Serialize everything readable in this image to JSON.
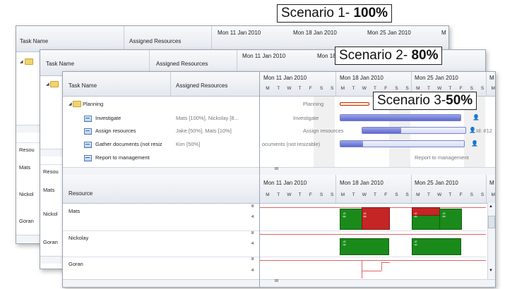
{
  "scenarios": {
    "s1": {
      "text": "Scenario 1- ",
      "bold": "100%"
    },
    "s2": {
      "text": "Scenario 2- ",
      "bold": "80%"
    },
    "s3": {
      "text": "Scenario 3-",
      "bold": "50%"
    }
  },
  "columns": {
    "task_name": "Task Name",
    "assigned_resources": "Assigned Resources",
    "resource": "Resource"
  },
  "weeks": [
    "Mon 11 Jan 2010",
    "Mon 18 Jan 2010",
    "Mon 25 Jan 2010",
    "M"
  ],
  "days": [
    "M",
    "T",
    "W",
    "T",
    "F",
    "S",
    "S"
  ],
  "tasks": [
    {
      "name": "Planning",
      "resources": ""
    },
    {
      "name": "Investigate",
      "resources": "Mats [100%], Nickolay [8..."
    },
    {
      "name": "Assign resources",
      "resources": "Jake [50%], Mats [10%]"
    },
    {
      "name": "Gather documents (not resiz",
      "resources": "Kim [50%]"
    },
    {
      "name": "Report to management",
      "resources": ""
    }
  ],
  "gantt_labels": {
    "planning": "Planning",
    "investigate": "Investigate",
    "assign": "Assign resources",
    "gather": "ocuments (not resizable)",
    "report": "Report to management",
    "id12": "Id: #12"
  },
  "resources": [
    "Mats",
    "Nickolay",
    "Goran"
  ],
  "back_resources": [
    "Resou",
    "Mats",
    "Nickol",
    "Goran"
  ],
  "scrollbar_thumb": "III",
  "axis_ticks": {
    "top": "8",
    "mid": "4"
  },
  "histogram_labels": {
    "a": "8 h",
    "b": "8 h",
    "c": "8 h",
    "d": "8 h",
    "e": "6 h",
    "f": "6 h"
  },
  "colors": {
    "over_allocated": "#c52525",
    "allocated": "#1a8a1a",
    "bar": "#5d68cc"
  }
}
